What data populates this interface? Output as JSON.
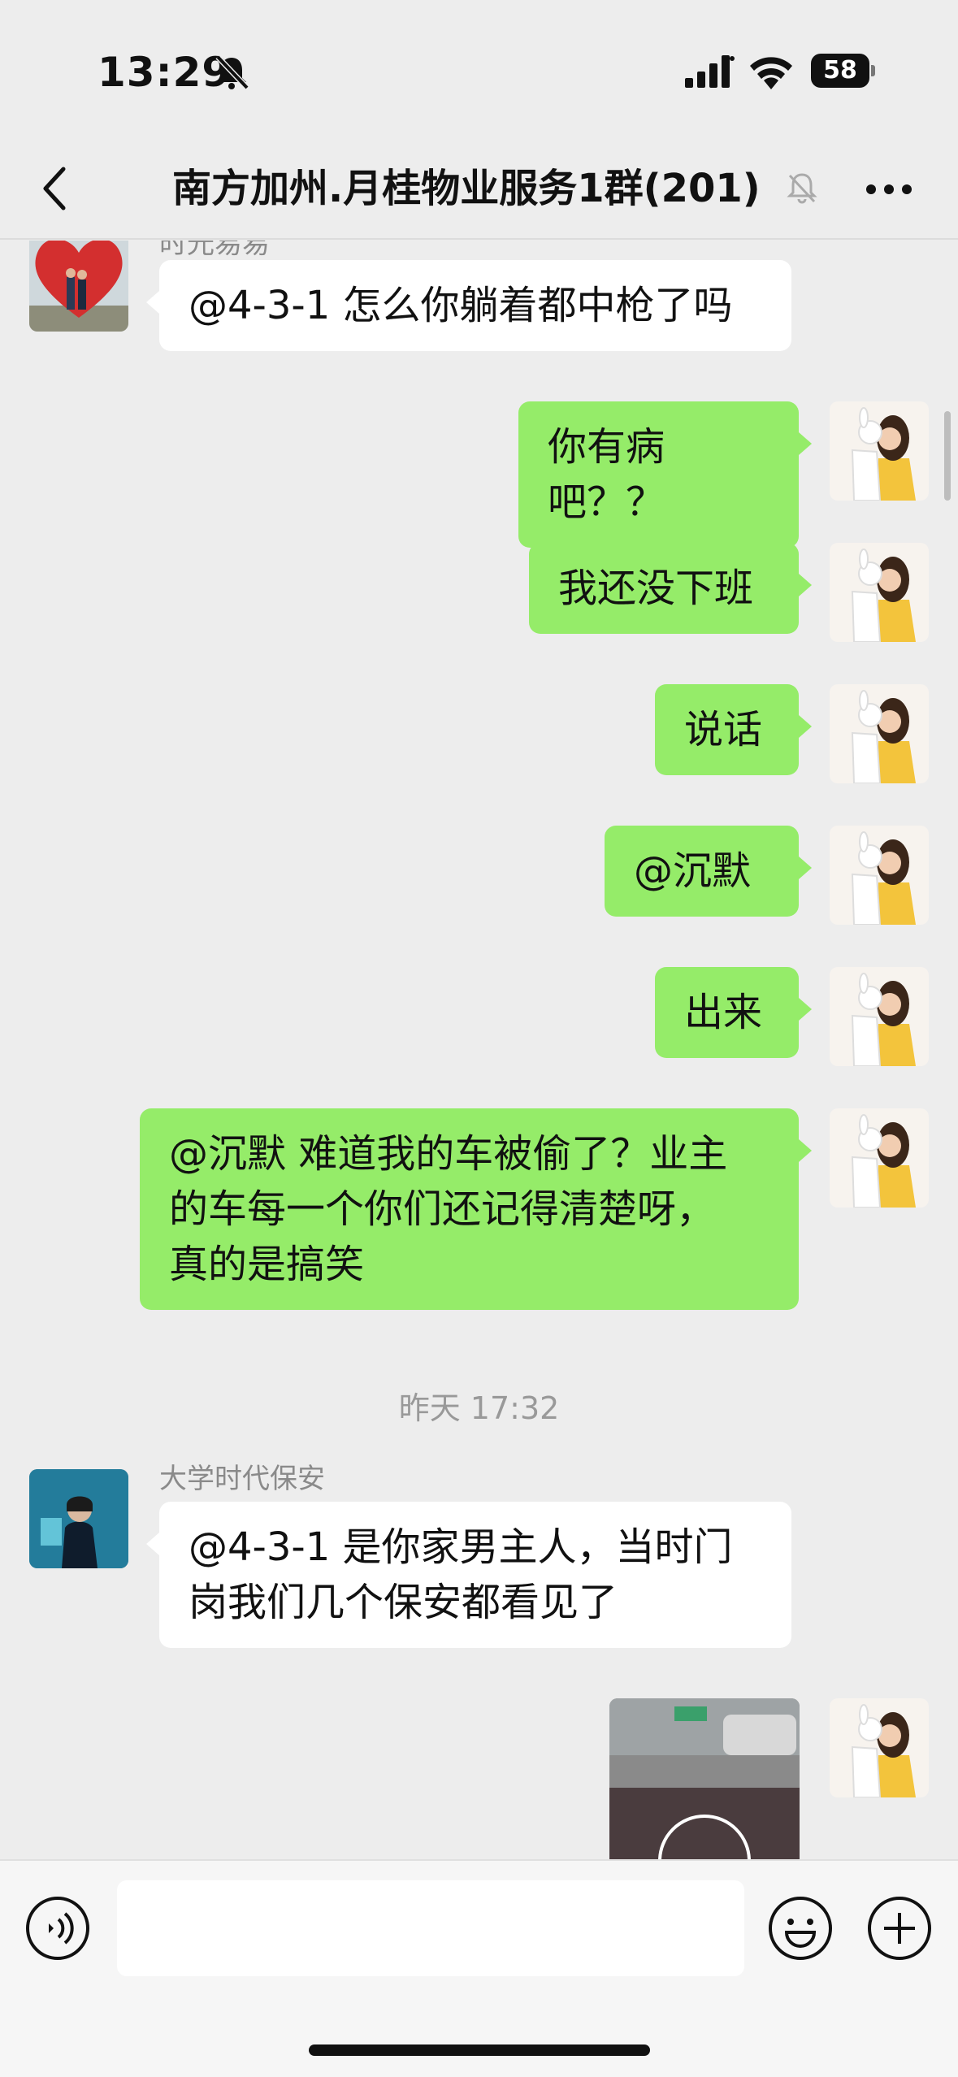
{
  "status_bar": {
    "time": "13:29",
    "battery": "58"
  },
  "header": {
    "back_icon": "chevron-left-icon",
    "title": "南方加州.月桂物业服务1群(201)",
    "mute_icon": "bell-off-icon",
    "more_icon": "ellipsis-icon"
  },
  "messages": [
    {
      "side": "left",
      "sender": "时光易易",
      "text": "@4-3-1 怎么你躺着都中枪了吗"
    },
    {
      "side": "right",
      "text": "你有病吧？？"
    },
    {
      "side": "right",
      "text": "我还没下班"
    },
    {
      "side": "right",
      "text": "说话"
    },
    {
      "side": "right",
      "text": "@沉默"
    },
    {
      "side": "right",
      "text": "出来"
    },
    {
      "side": "right",
      "text": "@沉默 难道我的车被偷了？业主\n的车每一个你们还记得清楚呀，\n真的是搞笑"
    }
  ],
  "timestamp": "昨天 17:32",
  "messages_after": [
    {
      "side": "left",
      "sender": "大学时代保安",
      "text": "@4-3-1 是你家男主人，当时门\n岗我们几个保安都看见了"
    },
    {
      "side": "right",
      "type": "video"
    }
  ],
  "input_bar": {
    "voice_icon": "voice-icon",
    "placeholder": "",
    "emoji_icon": "emoji-icon",
    "plus_icon": "plus-icon"
  },
  "colors": {
    "background": "#ededed",
    "bubble_self": "#95ec69",
    "bubble_other": "#ffffff"
  }
}
